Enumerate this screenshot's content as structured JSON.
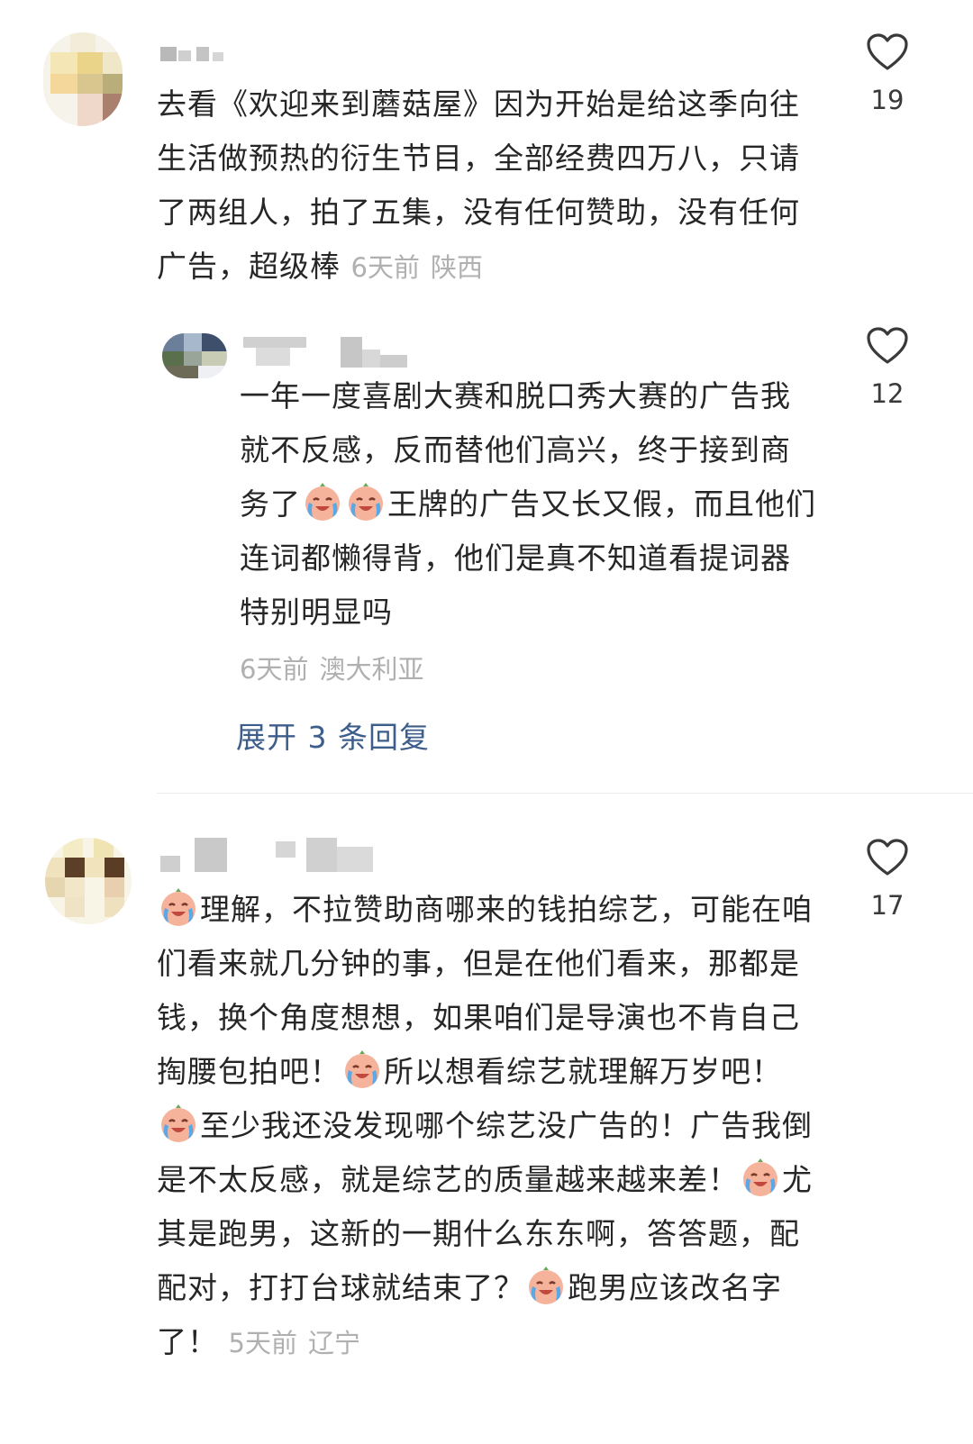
{
  "comments": [
    {
      "text_parts": [
        "去看《欢迎来到蘑菇屋》因为开始是给这季向往生活做预热的衍生节目，全部经费四万八，只请了两组人，拍了五集，没有任何赞助，没有任何广告，超级棒"
      ],
      "time": "6天前",
      "location": "陕西",
      "likes": "19"
    },
    {
      "text_parts": [
        "一年一度喜剧大赛和脱口秀大赛的广告我就不反感，反而替他们高兴，终于接到商务了",
        "王牌的广告又长又假，而且他们连词都懒得背，他们是真不知道看提词器特别明显吗"
      ],
      "time": "6天前",
      "location": "澳大利亚",
      "likes": "12"
    },
    {
      "text_parts": [
        "理解，不拉赞助商哪来的钱拍综艺，可能在咱们看来就几分钟的事，但是在他们看来，那都是钱，换个角度想想，如果咱们是导演也不肯自己掏腰包拍吧！",
        "所以想看综艺就理解万岁吧！",
        "至少我还没发现哪个综艺没广告的！广告我倒是不太反感，就是综艺的质量越来越来差！",
        "尤其是跑男，这新的一期什么东东啊，答答题，配配对，打打台球就结束了？",
        "跑男应该改名字了！"
      ],
      "time": "5天前",
      "location": "辽宁",
      "likes": "17"
    }
  ],
  "expand_replies": "展开 3 条回复",
  "emoji": "crying-laughing-face",
  "icons": {
    "like": "heart-outline-icon"
  },
  "colors": {
    "link": "#3d5d8a",
    "meta": "#b0b0b0",
    "text": "#262626"
  }
}
